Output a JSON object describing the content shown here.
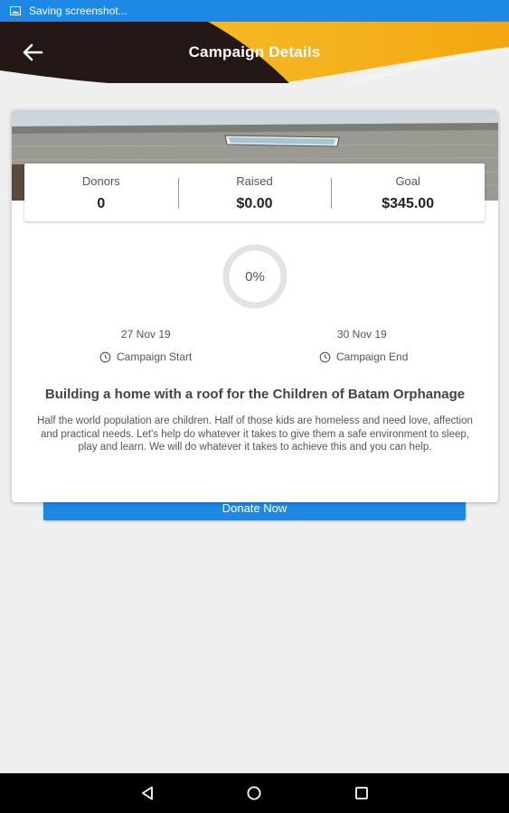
{
  "status_bar": {
    "text": "Saving screenshot..."
  },
  "header": {
    "title": "Campaign Details"
  },
  "stats": {
    "donors_label": "Donors",
    "donors_value": "0",
    "raised_label": "Raised",
    "raised_value": "$0.00",
    "goal_label": "Goal",
    "goal_value": "$345.00"
  },
  "progress": {
    "percent_text": "0%",
    "percent": 0
  },
  "dates": {
    "start_date": "27 Nov 19",
    "start_label": "Campaign Start",
    "end_date": "30 Nov 19",
    "end_label": "Campaign End"
  },
  "campaign": {
    "title": "Building a home with a roof for the Children of Batam Orphanage",
    "description": "Half the world population are children. Half of those kids are homeless and need love, affection and practical needs. Let's help do whatever it takes to give them a safe environment to sleep, play and learn. We will do whatever it takes to achieve this and you can help."
  },
  "donate_button": {
    "label": "Donate Now"
  },
  "colors": {
    "accent": "#1e88e5",
    "header_dark": "#231815",
    "header_gold": "#f5b820"
  }
}
